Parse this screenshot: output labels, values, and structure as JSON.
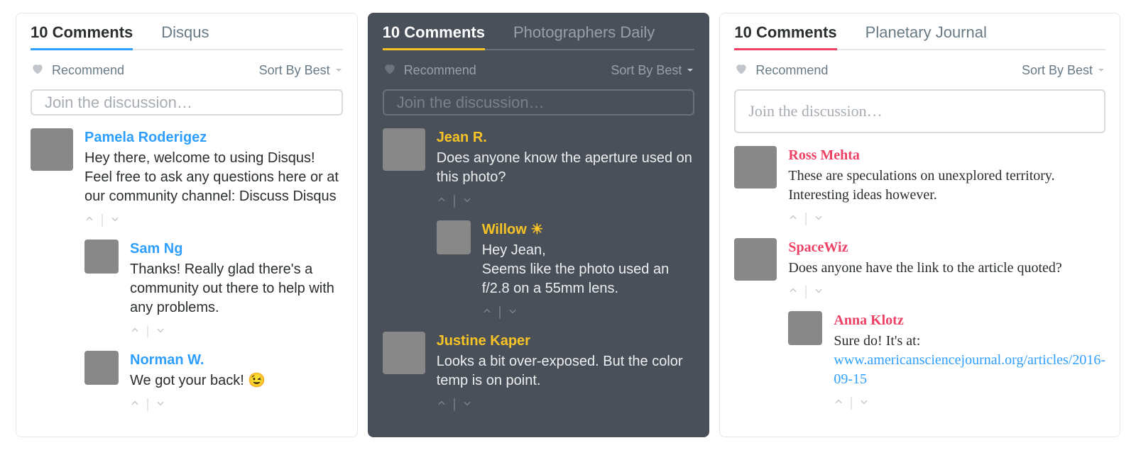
{
  "shared": {
    "count_label": "10 Comments",
    "recommend_label": "Recommend",
    "sort_label": "Sort By Best",
    "placeholder": "Join the discussion…"
  },
  "panels": [
    {
      "accent": "#2e9fff",
      "community": "Disqus",
      "comments": [
        {
          "author": "Pamela Roderigez",
          "text": "Hey there, welcome to using Disqus! Feel free to ask any questions here or at our community channel: Discuss Disqus"
        },
        {
          "author": "Sam Ng",
          "text": "Thanks! Really glad there's a community out there to help with any problems.",
          "reply": true
        },
        {
          "author": "Norman W.",
          "text": "We got your back! 😉",
          "reply": true
        }
      ]
    },
    {
      "accent": "#f7c325",
      "community": "Photographers Daily",
      "comments": [
        {
          "author": "Jean R.",
          "text": "Does anyone know the aperture used on this photo?"
        },
        {
          "author": "Willow ☀",
          "text": "Hey Jean,\nSeems like the photo used an f/2.8 on a 55mm lens.",
          "reply": true
        },
        {
          "author": "Justine Kaper",
          "text": "Looks a bit over-exposed. But the color temp is on point."
        }
      ]
    },
    {
      "accent": "#ed4065",
      "community": "Planetary Journal",
      "comments": [
        {
          "author": "Ross Mehta",
          "text": "These are speculations on unexplored territory. Interesting ideas however."
        },
        {
          "author": "SpaceWiz",
          "text": "Does anyone have the link to the article quoted?"
        },
        {
          "author": "Anna Klotz",
          "text": "Sure do! It's at: ",
          "reply": true,
          "link_text": "www.americansciencejournal.org/articles/2016-09-15"
        }
      ]
    }
  ]
}
